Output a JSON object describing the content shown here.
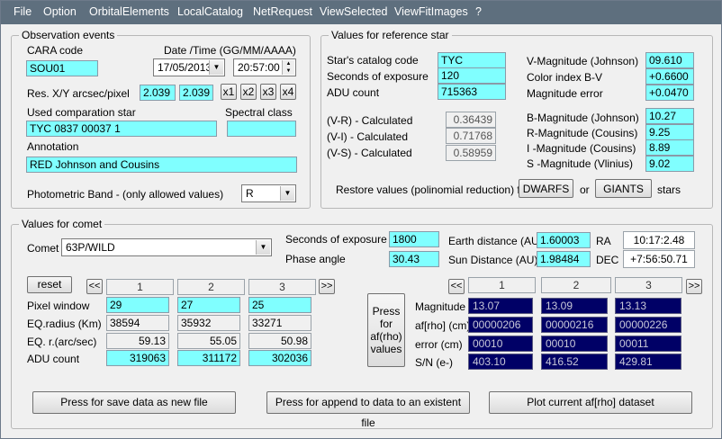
{
  "menu": [
    "File",
    "Option",
    "OrbitalElements",
    "LocalCatalog",
    "NetRequest",
    "ViewSelected",
    "ViewFitImages",
    "?"
  ],
  "observation": {
    "title": "Observation events",
    "cara_label": "CARA code",
    "cara_value": "SOU01",
    "date_label": "Date /Time  (GG/MM/AAAA)",
    "date_value": "17/05/2013",
    "time_value": "20:57:00",
    "res_label": "Res.  X/Y arcsec/pixel",
    "res_x": "2.039",
    "res_y": "2.039",
    "scale_buttons": [
      "x1",
      "x2",
      "x3",
      "x4"
    ],
    "comp_star_label": "Used comparation star",
    "comp_star_value": "TYC 0837 00037 1",
    "spectral_label": "Spectral class",
    "spectral_value": "",
    "annotation_label": "Annotation",
    "annotation_value": "RED Johnson and Cousins",
    "band_label": "Photometric Band  - (only allowed values)",
    "band_value": "R"
  },
  "reference": {
    "title": "Values for reference star",
    "catalog_label": "Star's catalog code",
    "catalog_value": "TYC",
    "exposure_label": "Seconds of exposure",
    "exposure_value": "120",
    "adu_label": "ADU count",
    "adu_value": "715363",
    "vr_label": "(V-R) - Calculated",
    "vr_value": "0.36439",
    "vi_label": "(V-I)  - Calculated",
    "vi_value": "0.71768",
    "vs_label": "(V-S) - Calculated",
    "vs_value": "0.58959",
    "vmag_label": "V-Magnitude (Johnson)",
    "vmag_value": "09.610",
    "bv_label": "Color index B-V",
    "bv_value": "+0.6600",
    "magerr_label": "Magnitude error",
    "magerr_value": "+0.0470",
    "bmag_label": "B-Magnitude (Johnson)",
    "bmag_value": "10.27",
    "rmag_label": "R-Magnitude (Cousins)",
    "rmag_value": "9.25",
    "imag_label": "I -Magnitude (Cousins)",
    "imag_value": "8.89",
    "smag_label": "S -Magnitude (Vlinius)",
    "smag_value": "9.02",
    "restore_label": "Restore values (polinomial reduction) for",
    "dwarfs_btn": "DWARFS",
    "or_label": "or",
    "giants_btn": "GIANTS",
    "stars_label": "stars"
  },
  "comet": {
    "title": "Values for comet",
    "comet_label": "Comet",
    "comet_value": "63P/WILD",
    "exposure_label": "Seconds of exposure",
    "exposure_value": "1800",
    "phase_label": "Phase angle",
    "phase_value": "30.43",
    "earth_label": "Earth distance (AU)",
    "earth_value": "1.60003",
    "sun_label": "Sun Distance (AU)",
    "sun_value": "1.98484",
    "ra_label": "RA",
    "ra_value": "10:17:2.48",
    "dec_label": "DEC",
    "dec_value": "+7:56:50.71",
    "reset_btn": "reset",
    "prev_btn": "<<",
    "next_btn": ">>",
    "col_headers": [
      "1",
      "2",
      "3"
    ],
    "left_rows": [
      {
        "label": "Pixel window",
        "values": [
          "29",
          "27",
          "25"
        ]
      },
      {
        "label": "EQ.radius (Km)",
        "values": [
          "38594",
          "35932",
          "33271"
        ]
      },
      {
        "label": "EQ. r.(arc/sec)",
        "values": [
          "59.13",
          "55.05",
          "50.98"
        ]
      },
      {
        "label": "ADU count",
        "values": [
          "319063",
          "311172",
          "302036"
        ]
      }
    ],
    "press_btn_lines": [
      "Press",
      "for",
      "af(rho)",
      "values"
    ],
    "right_rows": [
      {
        "label": "Magnitude",
        "values": [
          "13.07",
          "13.09",
          "13.13"
        ]
      },
      {
        "label": "af[rho] (cm)",
        "values": [
          "00000206",
          "00000216",
          "00000226"
        ]
      },
      {
        "label": "error (cm)",
        "values": [
          "00010",
          "00010",
          "00011"
        ]
      },
      {
        "label": "S/N (e-)",
        "values": [
          "403.10",
          "416.52",
          "429.81"
        ]
      }
    ]
  },
  "actions": {
    "save_btn": "Press for save data as new file",
    "append_btn": "Press for append to  data to an existent file",
    "plot_btn": "Plot current af[rho] dataset"
  }
}
